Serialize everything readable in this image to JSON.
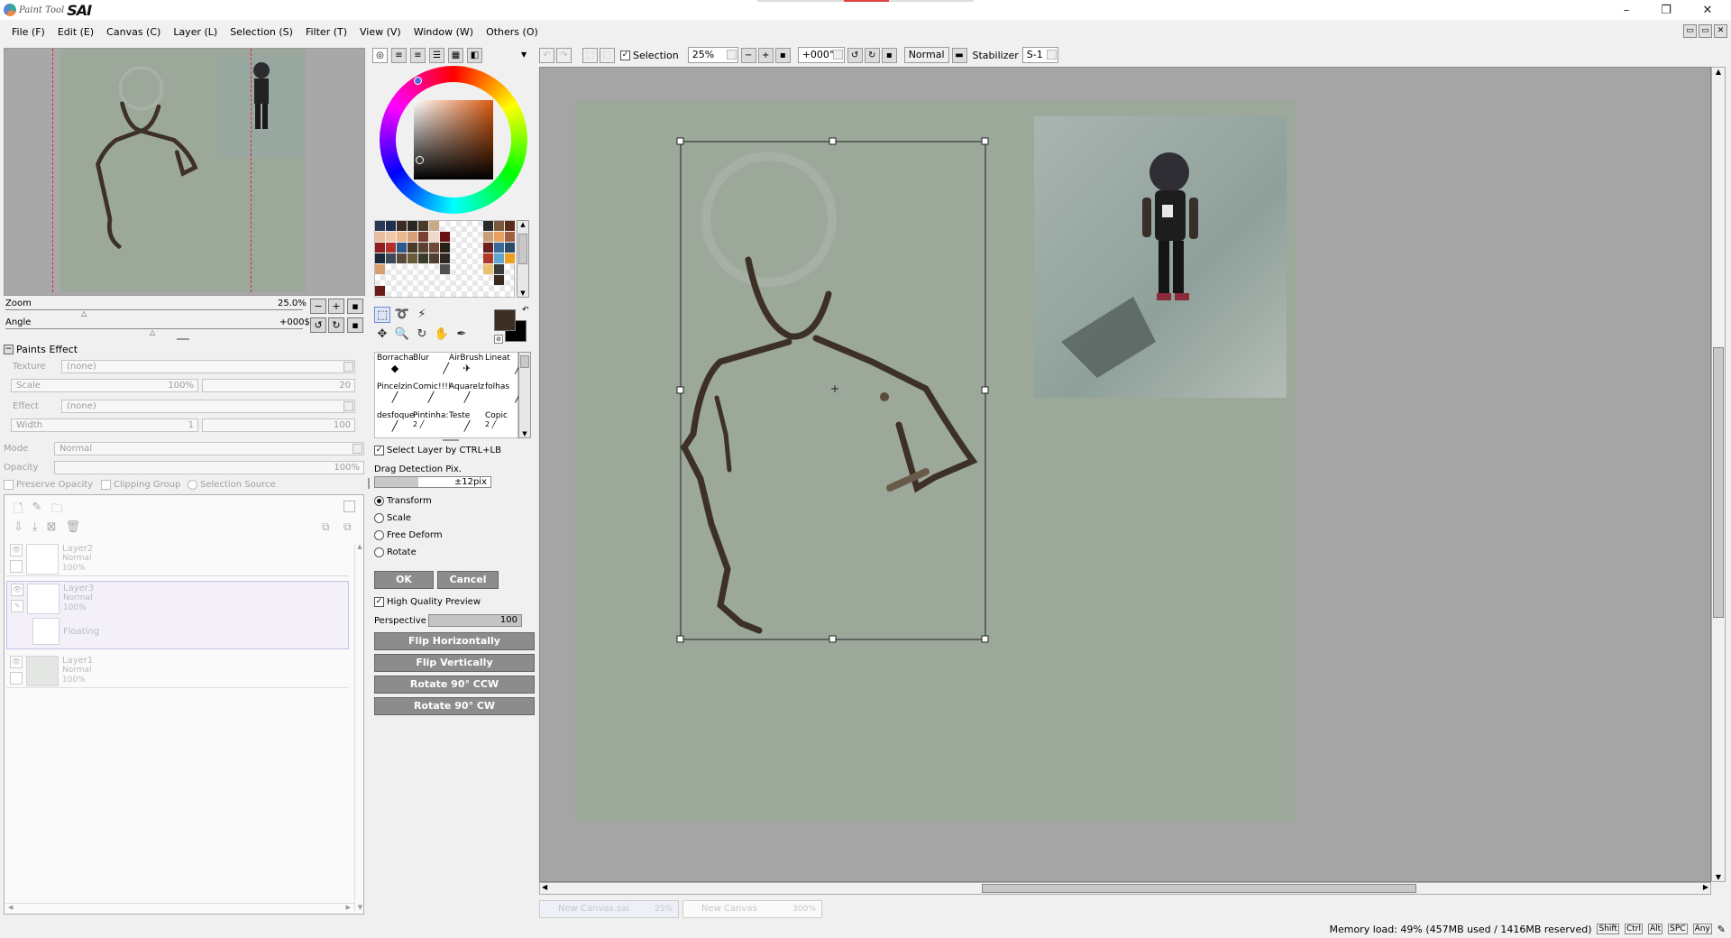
{
  "app": {
    "logo_small": "Paint Tool",
    "logo_big": "SAI"
  },
  "window_controls": {
    "minimize": "–",
    "restore": "❐",
    "close": "✕"
  },
  "menu": [
    "File (F)",
    "Edit (E)",
    "Canvas (C)",
    "Layer (L)",
    "Selection (S)",
    "Filter (T)",
    "View (V)",
    "Window (W)",
    "Others (O)"
  ],
  "navigator": {
    "zoom_label": "Zoom",
    "zoom_value": "25.0%",
    "angle_label": "Angle",
    "angle_value": "+000$"
  },
  "paints_effect": {
    "header": "Paints Effect",
    "texture_label": "Texture",
    "texture_value": "(none)",
    "scale_label": "Scale",
    "scale_value": "100%",
    "scale_right": "20",
    "effect_label": "Effect",
    "effect_value": "(none)",
    "width_label": "Width",
    "width_value": "1",
    "width_right": "100"
  },
  "layer_props": {
    "mode_label": "Mode",
    "mode_value": "Normal",
    "opacity_label": "Opacity",
    "opacity_value": "100%",
    "preserve_opacity": "Preserve Opacity",
    "clipping_group": "Clipping Group",
    "selection_source": "Selection Source"
  },
  "layers": [
    {
      "name": "Layer2",
      "mode": "Normal",
      "opacity": "100%"
    },
    {
      "name": "Layer3",
      "mode": "Normal",
      "opacity": "100%",
      "floating": "Floating"
    },
    {
      "name": "Layer1",
      "mode": "Normal",
      "opacity": "100%"
    }
  ],
  "colors": {
    "primary": "#3b2e25",
    "secondary": "#000000",
    "paper": "#9ba89a"
  },
  "brushes": [
    {
      "name": "Borracha",
      "size": ""
    },
    {
      "name": "Blur",
      "size": ""
    },
    {
      "name": "AirBrush",
      "size": ""
    },
    {
      "name": "Lineat",
      "size": ""
    },
    {
      "name": "Pincelzin",
      "size": ""
    },
    {
      "name": "Comic!!!!",
      "size": ""
    },
    {
      "name": "Aquarelz",
      "size": ""
    },
    {
      "name": "folhas",
      "size": ""
    },
    {
      "name": "desfoque",
      "size": ""
    },
    {
      "name": "Pintinha:",
      "size": "2"
    },
    {
      "name": "Teste",
      "size": ""
    },
    {
      "name": "Copic",
      "size": "2"
    }
  ],
  "transform_panel": {
    "select_layer": "Select Layer by CTRL+LB",
    "drag_label": "Drag Detection Pix.",
    "drag_value": "±12pix",
    "options": [
      "Transform",
      "Scale",
      "Free Deform",
      "Rotate"
    ],
    "ok": "OK",
    "cancel": "Cancel",
    "hq_preview": "High Quality Preview",
    "perspective_label": "Perspective",
    "perspective_value": "100",
    "flip_h": "Flip Horizontally",
    "flip_v": "Flip Vertically",
    "rot_ccw": "Rotate 90° CCW",
    "rot_cw": "Rotate 90° CW"
  },
  "toolbar": {
    "selection_label": "Selection",
    "zoom": "25%",
    "angle": "+000°",
    "blend": "Normal",
    "stabilizer_label": "Stabilizer",
    "stabilizer_value": "S-1"
  },
  "doc_tabs": [
    {
      "name": "New Canvas.sai",
      "zoom": "25%"
    },
    {
      "name": "New Canvas",
      "zoom": "300%"
    }
  ],
  "status": {
    "memory": "Memory load: 49% (457MB used / 1416MB reserved)",
    "keys": [
      "Shift",
      "Ctrl",
      "Alt",
      "SPC",
      "Any"
    ]
  }
}
